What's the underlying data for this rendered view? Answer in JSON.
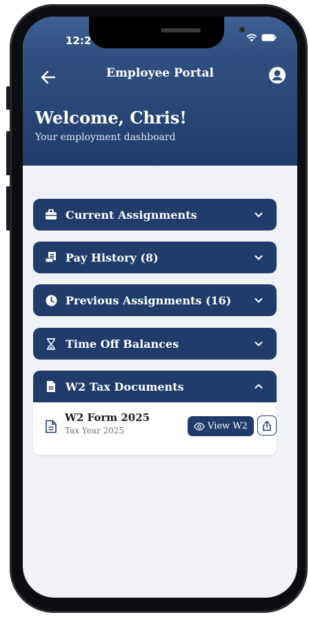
{
  "status_bar": {
    "time": "12:2",
    "icons": [
      "wifi-icon",
      "battery-icon"
    ]
  },
  "navbar": {
    "title": "Employee Portal",
    "back_icon": "arrow-left-icon",
    "profile_icon": "user-circle-icon"
  },
  "welcome": {
    "title": "Welcome, Chris!",
    "subtitle": "Your employment dashboard"
  },
  "sections": [
    {
      "label": "Current Assignments",
      "icon": "briefcase-icon",
      "expanded": false
    },
    {
      "label": "Pay History (8)",
      "icon": "receipt-icon",
      "expanded": false
    },
    {
      "label": "Previous Assignments (16)",
      "icon": "clock-icon",
      "expanded": false
    },
    {
      "label": "Time Off Balances",
      "icon": "hourglass-icon",
      "expanded": false
    },
    {
      "label": "W2 Tax Documents",
      "icon": "document-icon",
      "expanded": true
    }
  ],
  "w2_documents": [
    {
      "name": "W2 Form 2025",
      "subtitle": "Tax Year 2025",
      "view_label": "View W2"
    }
  ],
  "colors": {
    "primary": "#1f3c6b",
    "background": "#f1f2f5",
    "header_top": "#3e5f92"
  }
}
